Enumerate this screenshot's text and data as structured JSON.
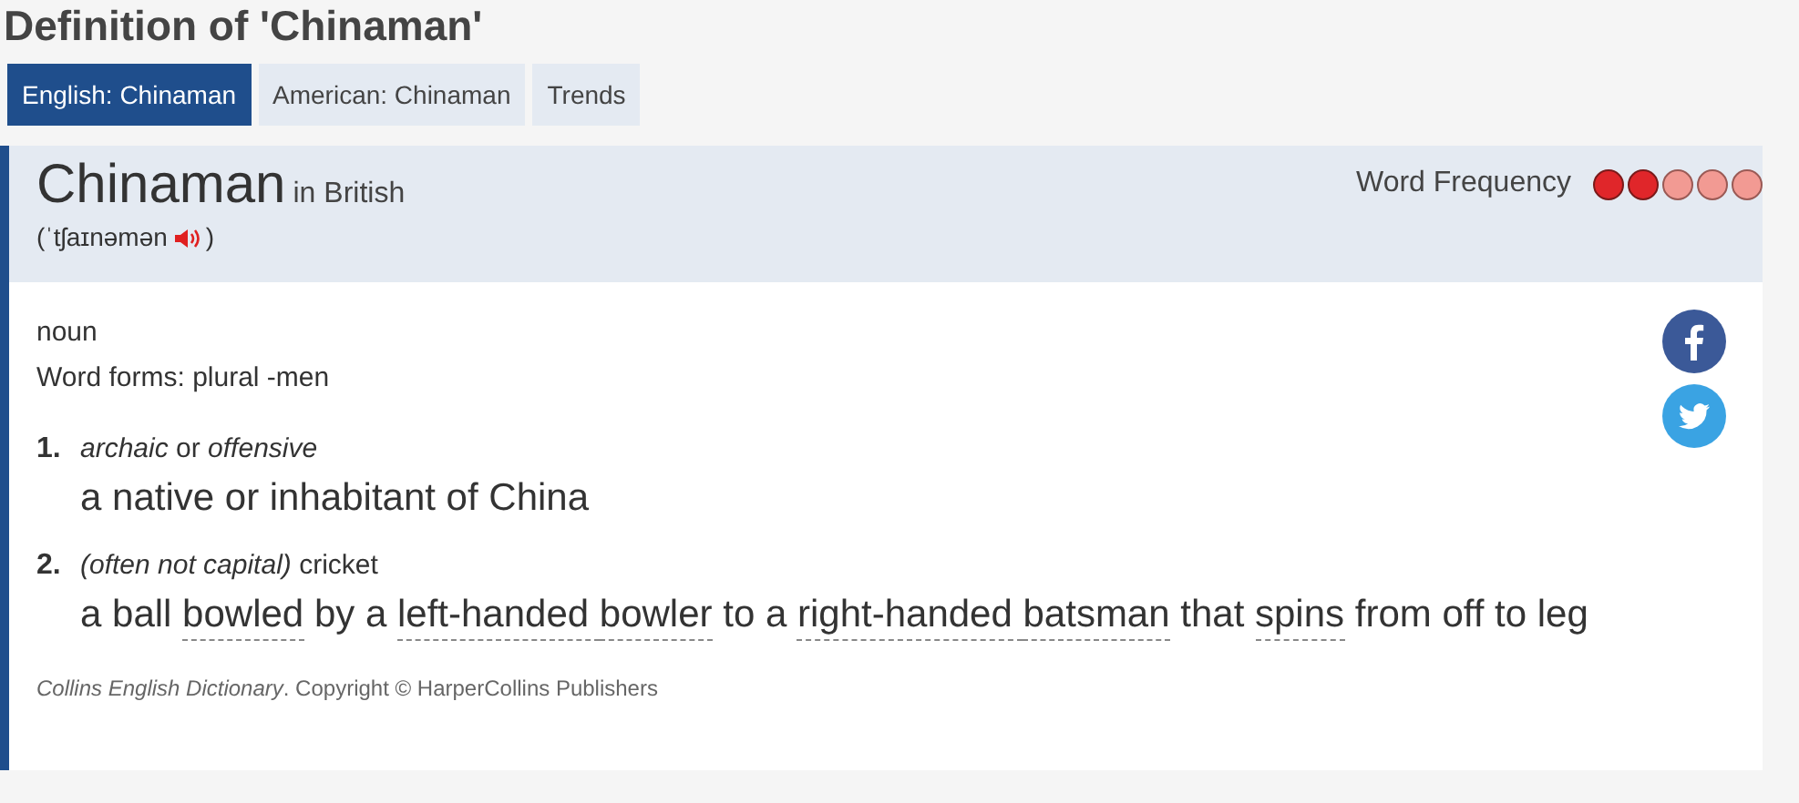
{
  "page_title": "Definition of 'Chinaman'",
  "tabs": [
    {
      "label": "English: Chinaman",
      "selected": true
    },
    {
      "label": "American: Chinaman",
      "selected": false
    },
    {
      "label": "Trends",
      "selected": false
    }
  ],
  "entry": {
    "headword": "Chinaman",
    "region": "in British",
    "pronunciation_open": "(ˈtʃaɪnəmən",
    "pronunciation_close": ")",
    "frequency": {
      "label": "Word Frequency",
      "dots": [
        {
          "filled": true
        },
        {
          "filled": true
        },
        {
          "filled": false
        },
        {
          "filled": false
        },
        {
          "filled": false
        }
      ]
    },
    "part_of_speech": "noun",
    "word_forms": "Word forms: plural -men",
    "senses": [
      {
        "number": "1.",
        "label": "*archaic* or *offensive*",
        "definition": [
          {
            "text": "a native or inhabitant of China",
            "link": false
          }
        ]
      },
      {
        "number": "2.",
        "label": "*(often not capital)* cricket",
        "definition": [
          {
            "text": "a ball ",
            "link": false
          },
          {
            "text": "bowled",
            "link": true
          },
          {
            "text": " by a ",
            "link": false
          },
          {
            "text": "left-handed ",
            "link": true
          },
          {
            "text": "bowler",
            "link": true
          },
          {
            "text": " to a ",
            "link": false
          },
          {
            "text": "right-handed ",
            "link": true
          },
          {
            "text": "batsman",
            "link": true
          },
          {
            "text": " that ",
            "link": false
          },
          {
            "text": "spins",
            "link": true
          },
          {
            "text": " from off to leg",
            "link": false
          }
        ]
      }
    ],
    "copyright": "*Collins English Dictionary*. Copyright © HarperCollins Publishers"
  }
}
